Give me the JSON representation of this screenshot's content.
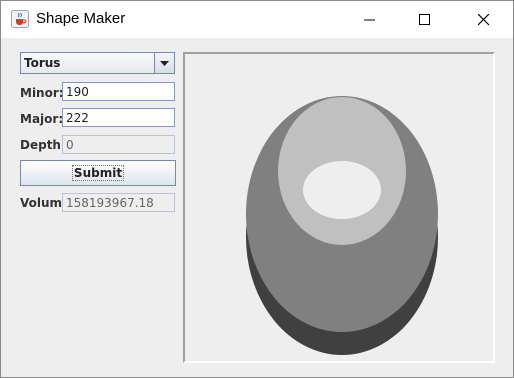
{
  "window": {
    "title": "Shape Maker",
    "app_icon": "java-cup-icon",
    "controls": [
      "minimize-icon",
      "maximize-icon",
      "close-icon"
    ]
  },
  "form": {
    "shape_select": {
      "value": "Torus"
    },
    "minor": {
      "label": "Minor:",
      "value": "190"
    },
    "major": {
      "label": "Major:",
      "value": "222"
    },
    "depth": {
      "label": "Depth:",
      "value": "0"
    },
    "submit_label": "Submit",
    "volume": {
      "label": "Volume",
      "value": "158193967.18"
    }
  },
  "canvas": {
    "shape": "torus",
    "colors": {
      "side": "#404040",
      "top": "#808080",
      "inner_wall": "#c0c0c0",
      "hole": "#eeeeee"
    }
  }
}
